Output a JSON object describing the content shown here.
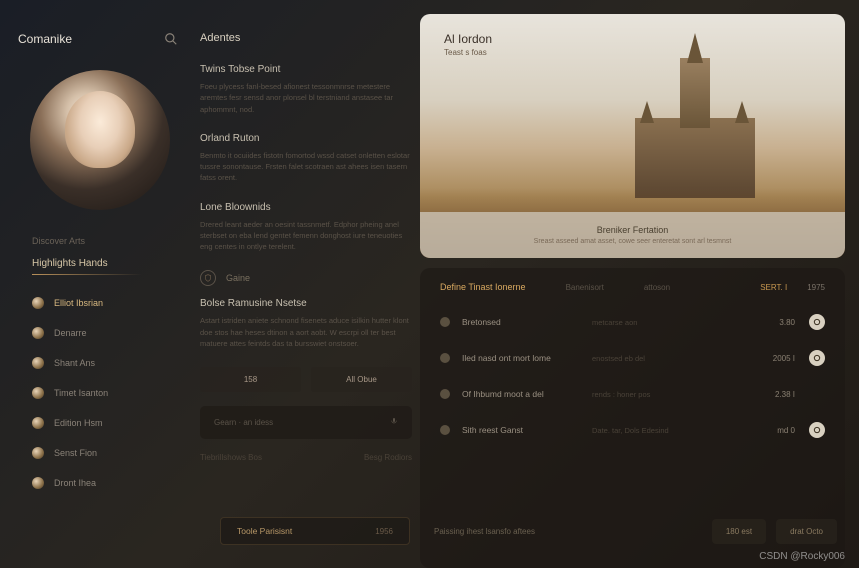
{
  "brand": "Comanike",
  "sidebar": {
    "label1": "Discover Arts",
    "header": "Highlights Hands",
    "items": [
      {
        "label": "Elliot Ibsrian"
      },
      {
        "label": "Denarre"
      },
      {
        "label": "Shant Ans"
      },
      {
        "label": "Timet Isanton"
      },
      {
        "label": "Edition Hsm"
      },
      {
        "label": "Senst Fion"
      },
      {
        "label": "Dront Ihea"
      }
    ]
  },
  "center": {
    "title": "Adentes",
    "blocks": [
      {
        "heading": "Twins Tobse Point",
        "text": "Foeu plycess fanl-besed afionest tessonmnrse metestere aremtes fesr sensd anor plonsel bl terstniand anstasee tar aphommnt, nod."
      },
      {
        "heading": "Orland Ruton",
        "text": "Benmto it ocuiides fistotn fomortod wssd catset onletten eslotar tussre sonontause. Frsten falet scotraen ast ahees isen tasern fatss orent."
      },
      {
        "heading": "Lone Bloownids",
        "text": "Drered leant aeder an oesint tassnmetf. Edphor pheing anel sterbset on eba lend gentet femenn donghost iure teneuoties eng centes in ontlye terelent."
      }
    ],
    "iconLabel": "Gaine",
    "subblock": {
      "heading": "Bolse Ramusine Nsetse",
      "text": "Astart istriden aniete schnond fisenets aduce isilkin hutter klont doe stos hae heses dtinon a aort aobt. W escrpi oll ter best matuere attes feintds das ta bursswiet onstsoer."
    },
    "buttons": [
      "158",
      "All Obue"
    ],
    "input": {
      "placeholder": "Gearn  ·  an idess"
    },
    "meta": [
      "Tiebrillshows Bos",
      "Besg Rodiors"
    ]
  },
  "hero": {
    "title": "Al Iordon",
    "subtitle": "Teast s foas",
    "footerTitle": "Breniker Fertation",
    "footerText": "Sreast asseed amat asset, cowe seer enteretat sont arl tesmnst"
  },
  "list": {
    "header": {
      "main": "Define Tinast Ionerne",
      "col2": "Banenisort",
      "col3": "attoson",
      "r1": "SERT. I",
      "r2": "1975"
    },
    "rows": [
      {
        "name": "Bretonsed",
        "meta": "metcarse aon",
        "value": "3.80",
        "action": true
      },
      {
        "name": "Iled nasd ont mort lome",
        "meta": "enostsed eb del",
        "value": "2005  I",
        "action": true
      },
      {
        "name": "Of Ihbumd moot a del",
        "meta": "rends : honer pos",
        "value": "2.38  I",
        "action": false
      },
      {
        "name": "Sith reest Ganst",
        "meta": "Date. tar, Dols Edesind",
        "value": "md 0",
        "action": true
      }
    ]
  },
  "bottomBar": {
    "pill": {
      "label": "Toole Parisisnt",
      "count": "1956"
    },
    "text": "Paissing ihest lsansfo aftees",
    "actions": [
      "180 est",
      "drat Octo"
    ]
  },
  "watermark": "CSDN @Rocky006"
}
